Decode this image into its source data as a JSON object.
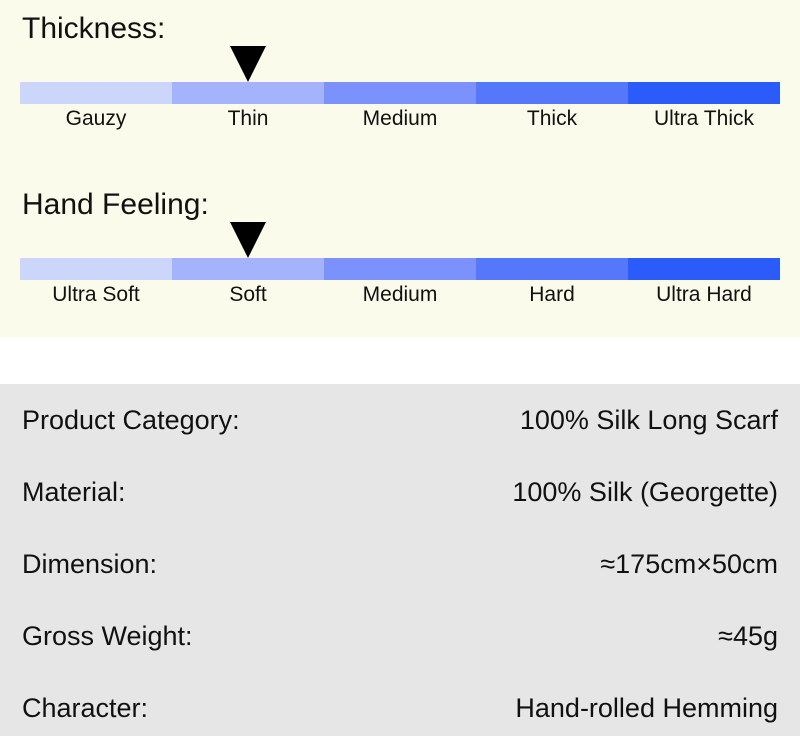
{
  "scales": [
    {
      "id": "thickness",
      "title": "Thickness:",
      "marker_segment_index": 1,
      "segments": [
        {
          "label": "Gauzy",
          "color": "#ccd6fb"
        },
        {
          "label": "Thin",
          "color": "#a3b4fc"
        },
        {
          "label": "Medium",
          "color": "#7b92fd"
        },
        {
          "label": "Thick",
          "color": "#5578fb"
        },
        {
          "label": "Ultra Thick",
          "color": "#2b5cfa"
        }
      ]
    },
    {
      "id": "hand-feeling",
      "title": "Hand Feeling:",
      "marker_segment_index": 1,
      "segments": [
        {
          "label": "Ultra Soft",
          "color": "#ccd6fb"
        },
        {
          "label": "Soft",
          "color": "#a3b4fc"
        },
        {
          "label": "Medium",
          "color": "#7b92fd"
        },
        {
          "label": "Hard",
          "color": "#5578fb"
        },
        {
          "label": "Ultra Hard",
          "color": "#2b5cfa"
        }
      ]
    }
  ],
  "specs": {
    "rows": [
      {
        "key": "Product Category:",
        "value": "100% Silk Long Scarf"
      },
      {
        "key": "Material:",
        "value": "100% Silk (Georgette)"
      },
      {
        "key": "Dimension:",
        "value": "≈175cm×50cm"
      },
      {
        "key": "Gross Weight:",
        "value": "≈45g"
      },
      {
        "key": "Character:",
        "value": "Hand-rolled Hemming"
      }
    ]
  },
  "colors": {
    "panel_background": "#fbfbeb",
    "separator_background": "#ffffff",
    "spec_background": "#e6e6e6",
    "marker": "#000000",
    "text": "#111111"
  }
}
